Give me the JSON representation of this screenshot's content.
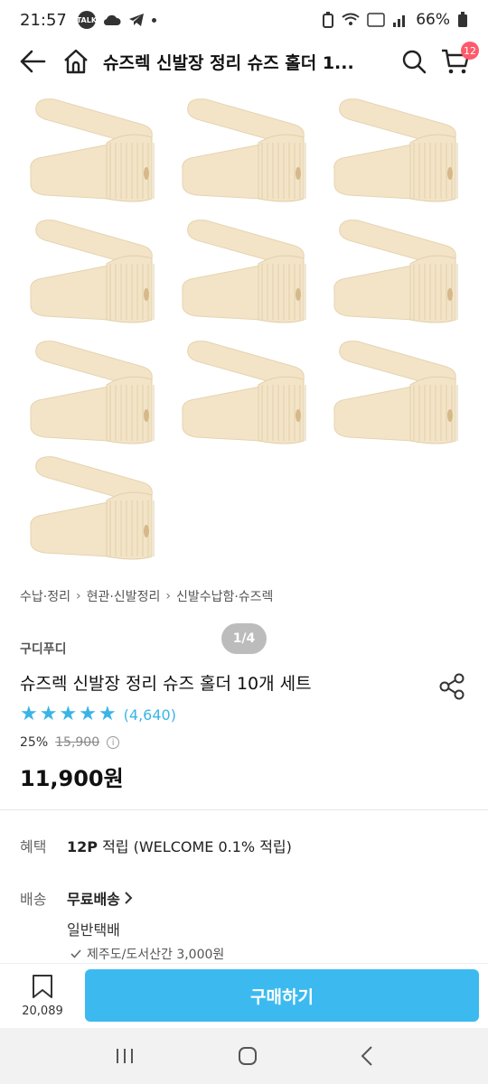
{
  "status": {
    "time": "21:57",
    "battery": "66%",
    "talk": "TALK"
  },
  "header": {
    "title": "슈즈렉 신발장 정리 슈즈 홀더 1...",
    "cart_count": "12"
  },
  "gallery": {
    "page_indicator": "1/4"
  },
  "breadcrumb": {
    "items": [
      "수납·정리",
      "현관·신발정리",
      "신발수납함·슈즈렉"
    ]
  },
  "product": {
    "seller": "구디푸디",
    "name": "슈즈렉 신발장 정리 슈즈 홀더 10개 세트",
    "rating_count": "(4,640)",
    "rating": 5,
    "discount": "25%",
    "original_price": "15,900",
    "price": "11,900원"
  },
  "benefit": {
    "label": "혜택",
    "points": "12P",
    "text": " 적립 (WELCOME 0.1% 적립)"
  },
  "shipping": {
    "label": "배송",
    "value": "무료배송",
    "method": "일반택배",
    "note": "제주도/도서산간 3,000원"
  },
  "bottom": {
    "wish_count": "20,089",
    "buy_label": "구매하기"
  },
  "colors": {
    "accent": "#3cbaf0",
    "star": "#3ab4e6",
    "badge": "#ff5a6b",
    "holder": "#f3e4c8"
  }
}
